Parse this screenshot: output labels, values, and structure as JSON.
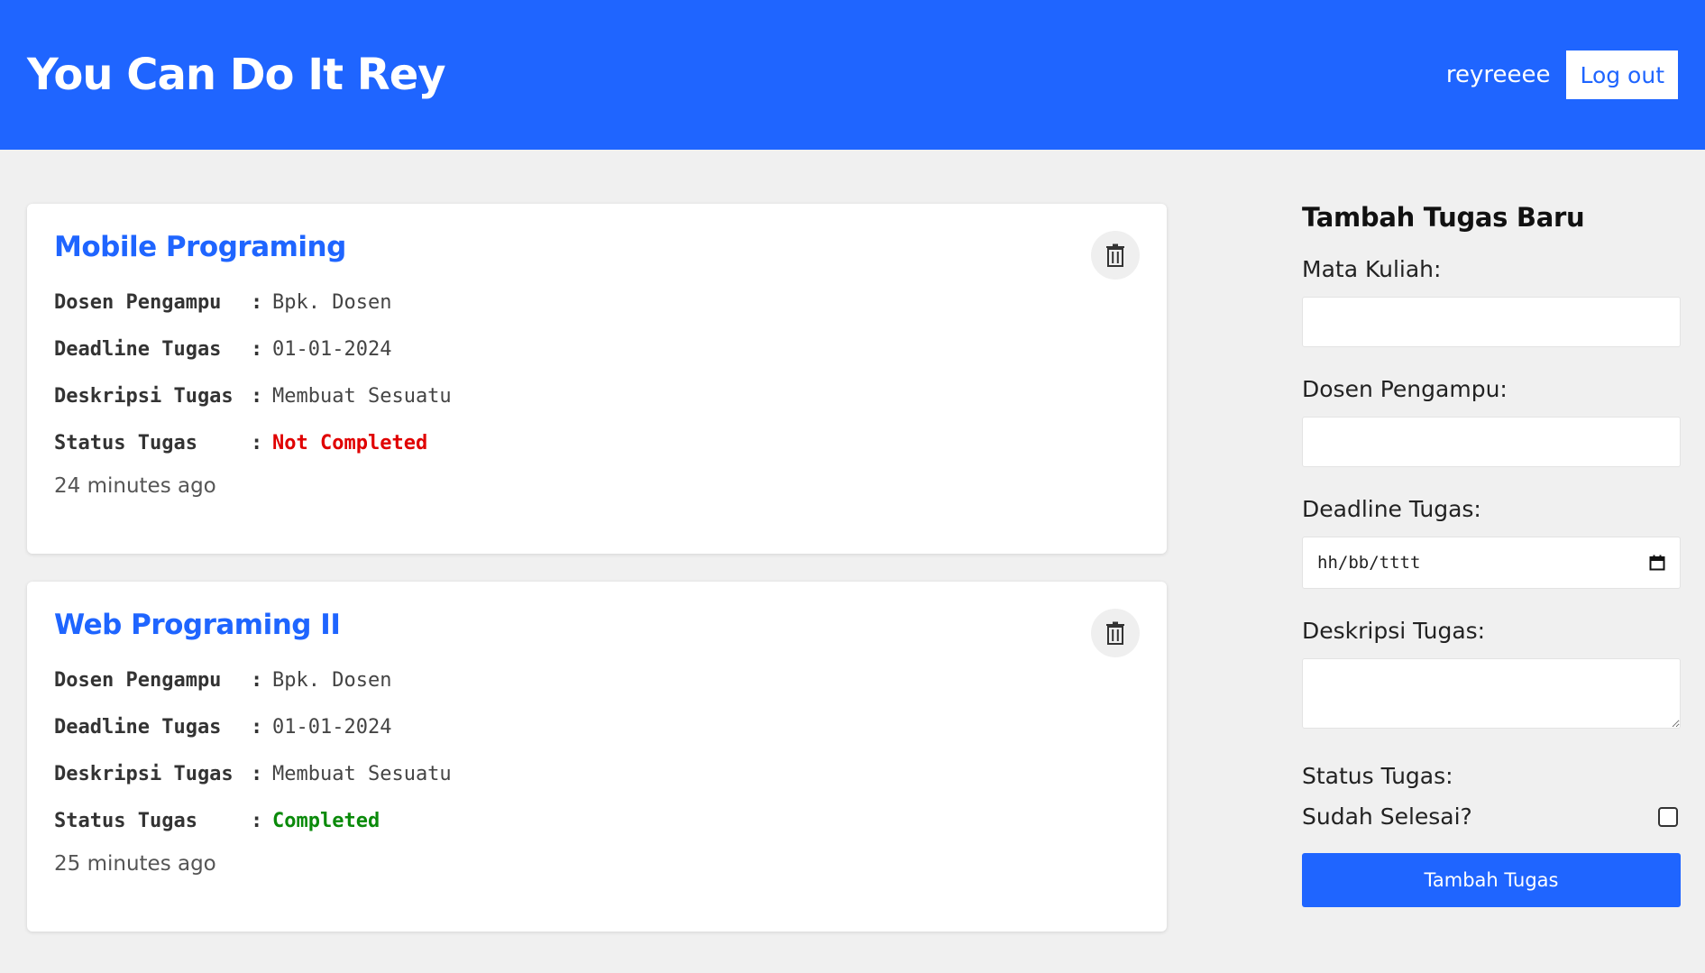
{
  "header": {
    "title": "You Can Do It Rey",
    "username": "reyreeee",
    "logout_label": "Log out",
    "bg_color": "#1f65ff"
  },
  "tasks": [
    {
      "title": "Mobile Programing",
      "dosen_label": "Dosen Pengampu",
      "dosen_value": "Bpk. Dosen",
      "deadline_label": "Deadline Tugas",
      "deadline_value": "01-01-2024",
      "desc_label": "Deskripsi Tugas",
      "desc_value": "Membuat Sesuatu",
      "status_label": "Status Tugas",
      "status_value": "Not Completed",
      "status_color": "#e00000",
      "time_ago": "24 minutes ago",
      "delete_icon": "trash-icon"
    },
    {
      "title": "Web Programing II",
      "dosen_label": "Dosen Pengampu",
      "dosen_value": "Bpk. Dosen",
      "deadline_label": "Deadline Tugas",
      "deadline_value": "01-01-2024",
      "desc_label": "Deskripsi Tugas",
      "desc_value": "Membuat Sesuatu",
      "status_label": "Status Tugas",
      "status_value": "Completed",
      "status_color": "#0a8a0a",
      "time_ago": "25 minutes ago",
      "delete_icon": "trash-icon"
    }
  ],
  "separator": ":",
  "form": {
    "heading": "Tambah Tugas Baru",
    "mata_kuliah_label": "Mata Kuliah:",
    "mata_kuliah_value": "",
    "dosen_label": "Dosen Pengampu:",
    "dosen_value": "",
    "deadline_label": "Deadline Tugas:",
    "deadline_placeholder": "hh/bb/tttt",
    "deskripsi_label": "Deskripsi Tugas:",
    "deskripsi_value": "",
    "status_label": "Status Tugas:",
    "checkbox_label": "Sudah Selesai?",
    "checkbox_checked": false,
    "submit_label": "Tambah Tugas",
    "calendar_icon": "calendar-icon"
  }
}
